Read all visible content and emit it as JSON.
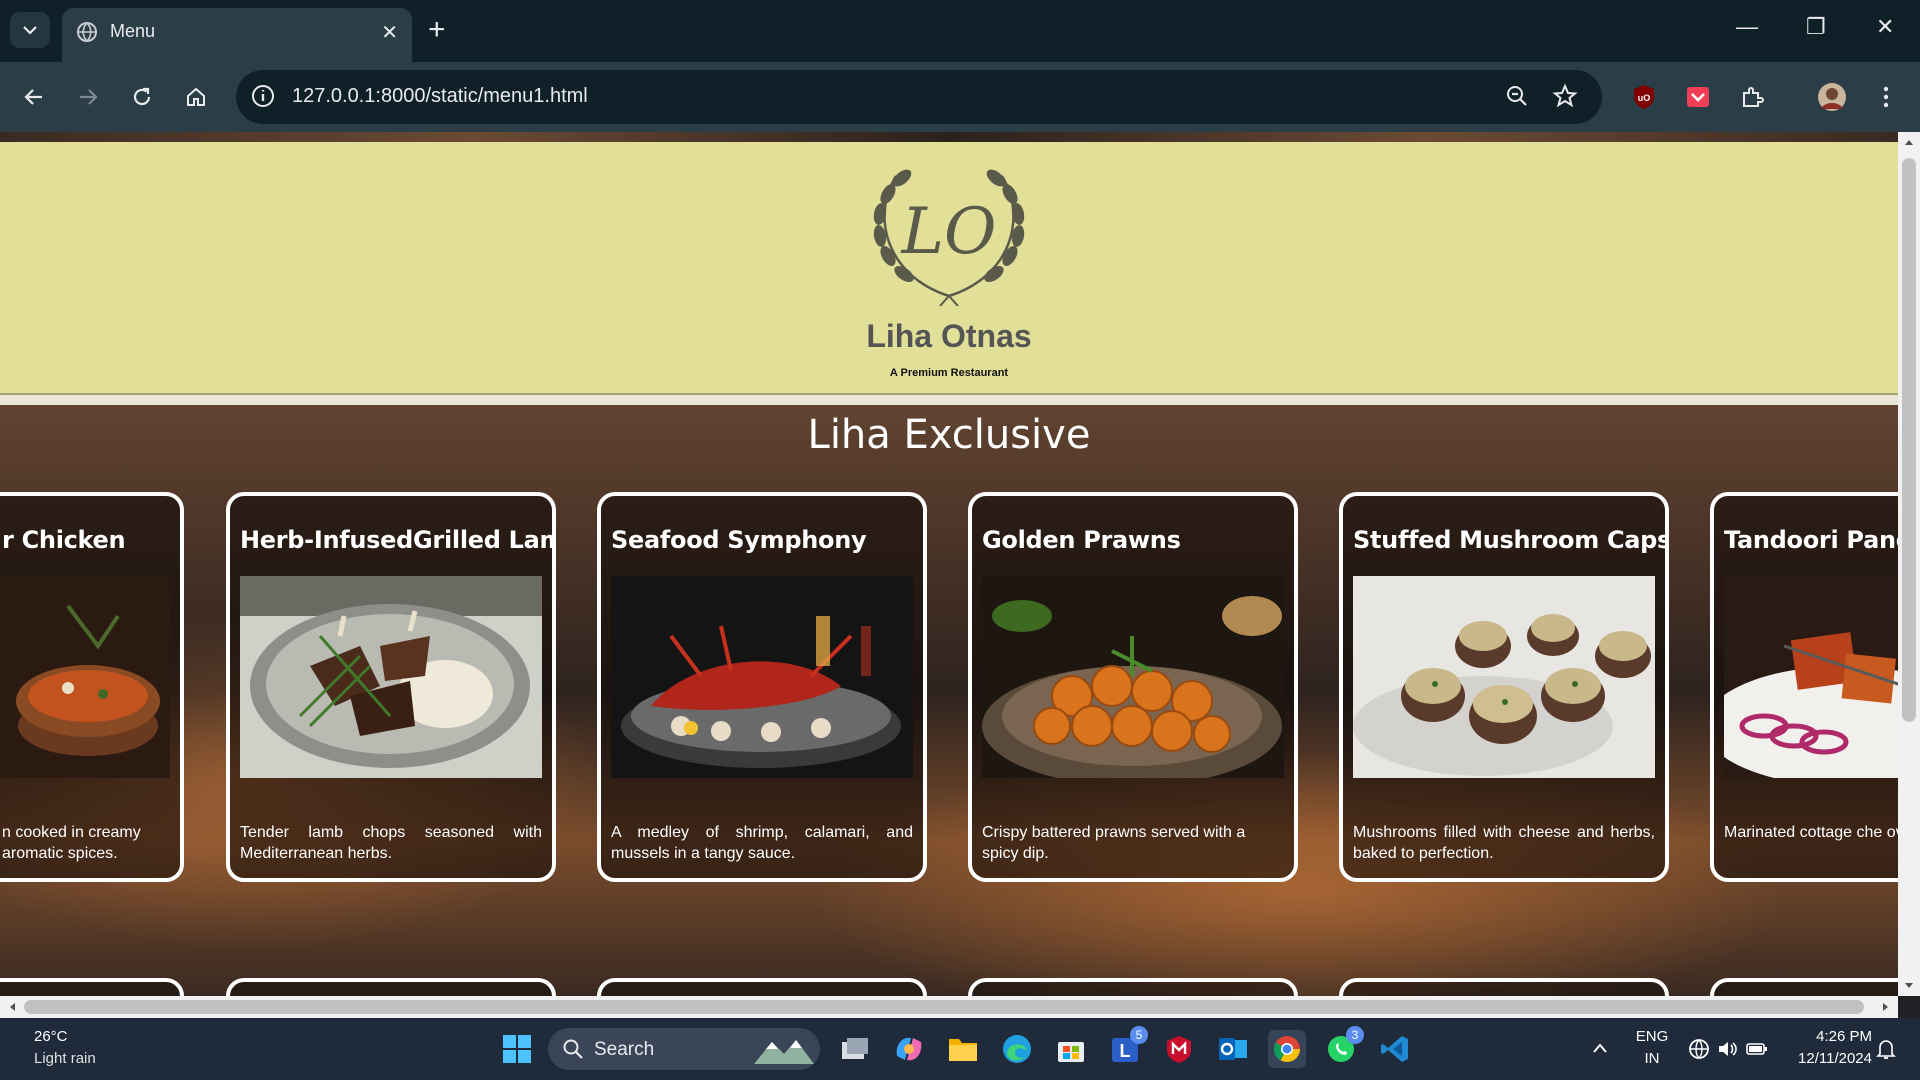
{
  "browser": {
    "tab_title": "Menu",
    "tab_close": "✕",
    "new_tab": "+",
    "url": "127.0.0.1:8000/static/menu1.html",
    "window_minimize": "—",
    "window_restore": "❐",
    "window_close": "✕"
  },
  "page": {
    "logo_text": "LO",
    "brand_name": "Liha Otnas",
    "tagline": "A Premium Restaurant",
    "section_title": "Liha Exclusive",
    "cards": [
      {
        "title": "r Chicken",
        "desc": "n cooked in creamy aromatic spices."
      },
      {
        "title": "Herb-InfusedGrilled Lamb",
        "desc": "Tender lamb chops seasoned with Mediterranean herbs."
      },
      {
        "title": "Seafood Symphony",
        "desc": "A medley of shrimp, calamari, and mussels in a tangy sauce."
      },
      {
        "title": "Golden Prawns",
        "desc": "Crispy battered prawns served with a spicy dip."
      },
      {
        "title": "Stuffed Mushroom Caps",
        "desc": "Mushrooms filled with cheese and herbs, baked to perfection."
      },
      {
        "title": "Tandoori Panee",
        "desc": "Marinated cottage che over charcoal."
      }
    ]
  },
  "taskbar": {
    "weather_temp": "26°C",
    "weather_desc": "Light rain",
    "search_label": "Search",
    "lang_top": "ENG",
    "lang_bottom": "IN",
    "time": "4:26 PM",
    "date": "12/11/2024",
    "badge_teams": "5",
    "badge_whatsapp": "3"
  }
}
